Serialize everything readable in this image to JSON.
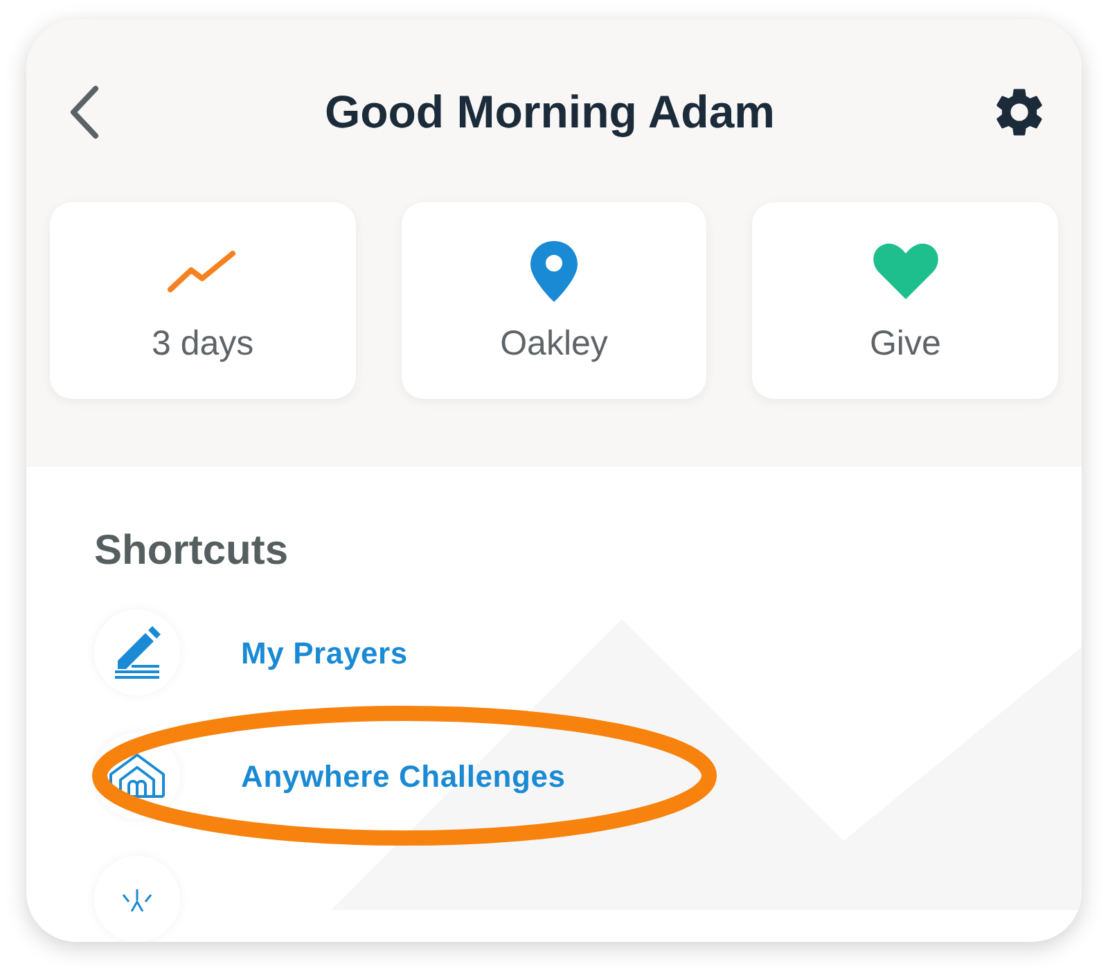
{
  "header": {
    "title": "Good Morning Adam"
  },
  "tiles": [
    {
      "kind": "streak",
      "label": "3 days"
    },
    {
      "kind": "location",
      "label": "Oakley"
    },
    {
      "kind": "give",
      "label": "Give"
    }
  ],
  "shortcuts": {
    "title": "Shortcuts",
    "items": [
      {
        "kind": "prayers",
        "label": "My Prayers",
        "highlighted": false
      },
      {
        "kind": "challenges",
        "label": "Anywhere Challenges",
        "highlighted": true
      },
      {
        "kind": "light",
        "highlighted": false
      }
    ]
  }
}
